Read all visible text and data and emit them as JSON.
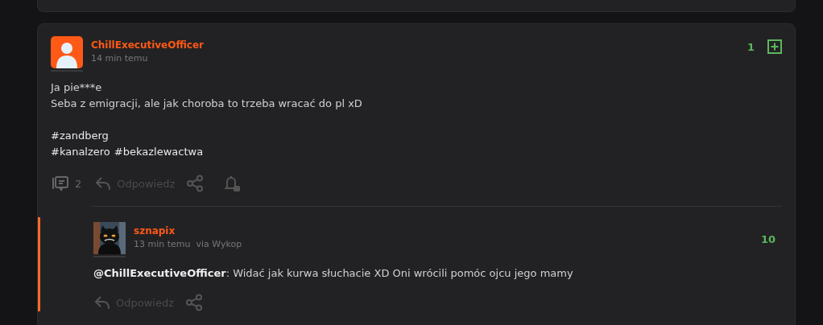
{
  "post": {
    "author": "ChillExecutiveOfficer",
    "time": "14 min temu",
    "votes": "1",
    "lines": [
      "Ja pie***e",
      "Seba z emigracji, ale jak choroba to trzeba wracać do pl xD"
    ],
    "tag_lines": [
      [
        "#zandberg"
      ],
      [
        "#kanalzero",
        "#bekazlewactwa"
      ]
    ],
    "comments_count": "2",
    "reply_label": "Odpowiedz"
  },
  "reply": {
    "author": "sznapix",
    "time": "13 min temu",
    "source": "via Wykop",
    "votes": "10",
    "text": "**@ChillExecutiveOfficer**: Widać jak kurwa słuchacie XD Oni wrócili pomóc ojcu jego mamy",
    "reply_label": "Odpowiedz"
  }
}
